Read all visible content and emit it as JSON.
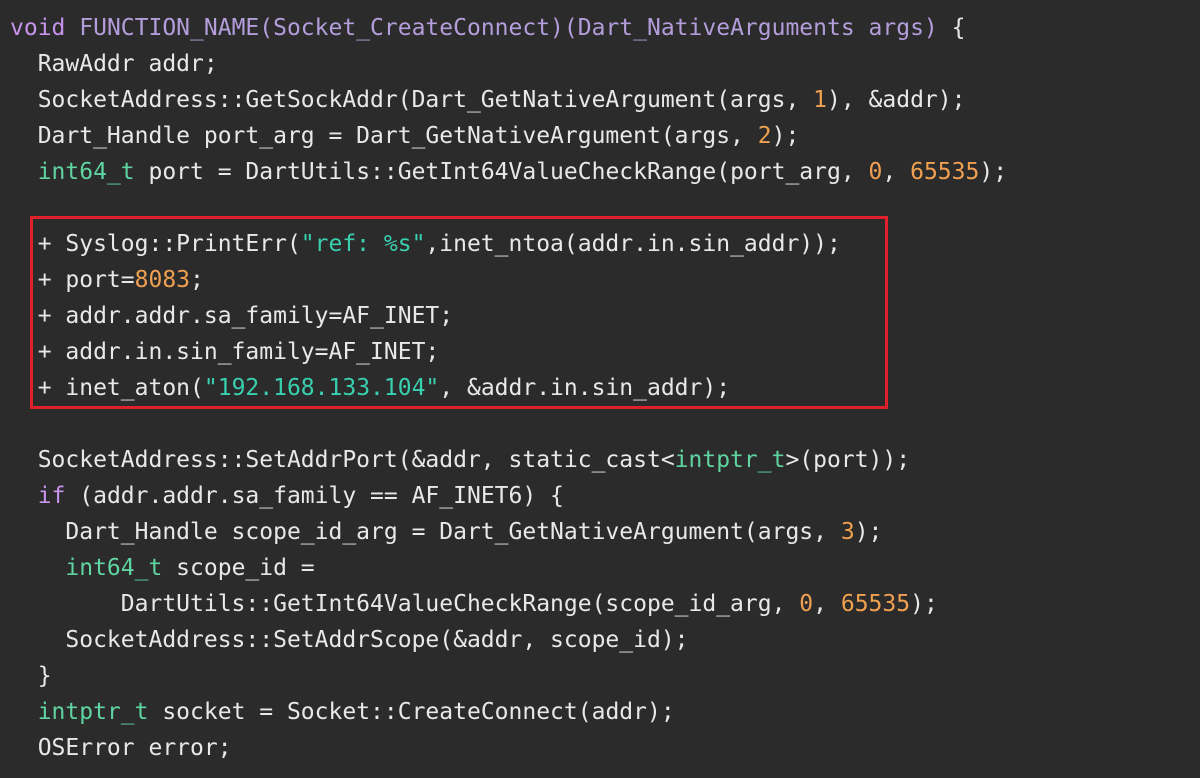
{
  "lines": [
    [
      {
        "t": "void ",
        "c": "kw"
      },
      {
        "t": "FUNCTION_NAME(Socket_CreateConnect)(Dart_NativeArguments args) ",
        "c": "sig"
      },
      {
        "t": "{",
        "c": "plain"
      }
    ],
    [
      {
        "t": "  RawAddr addr;",
        "c": "plain"
      }
    ],
    [
      {
        "t": "  SocketAddress::GetSockAddr(Dart_GetNativeArgument(args, ",
        "c": "plain"
      },
      {
        "t": "1",
        "c": "num"
      },
      {
        "t": "), &addr);",
        "c": "plain"
      }
    ],
    [
      {
        "t": "  Dart_Handle port_arg = Dart_GetNativeArgument(args, ",
        "c": "plain"
      },
      {
        "t": "2",
        "c": "num"
      },
      {
        "t": ");",
        "c": "plain"
      }
    ],
    [
      {
        "t": "  ",
        "c": "plain"
      },
      {
        "t": "int64_t",
        "c": "type"
      },
      {
        "t": " port = DartUtils::GetInt64ValueCheckRange(port_arg, ",
        "c": "plain"
      },
      {
        "t": "0",
        "c": "num"
      },
      {
        "t": ", ",
        "c": "plain"
      },
      {
        "t": "65535",
        "c": "num"
      },
      {
        "t": ");",
        "c": "plain"
      }
    ],
    [
      {
        "t": "",
        "c": "plain"
      }
    ],
    [
      {
        "t": "  + Syslog::PrintErr(",
        "c": "plain"
      },
      {
        "t": "\"ref: %s\"",
        "c": "str"
      },
      {
        "t": ",inet_ntoa(addr.in.sin_addr));",
        "c": "plain"
      }
    ],
    [
      {
        "t": "  + port=",
        "c": "plain"
      },
      {
        "t": "8083",
        "c": "num"
      },
      {
        "t": ";",
        "c": "plain"
      }
    ],
    [
      {
        "t": "  + addr.addr.sa_family=AF_INET;",
        "c": "plain"
      }
    ],
    [
      {
        "t": "  + addr.in.sin_family=AF_INET;",
        "c": "plain"
      }
    ],
    [
      {
        "t": "  + inet_aton(",
        "c": "plain"
      },
      {
        "t": "\"192.168.133.104\"",
        "c": "str"
      },
      {
        "t": ", &addr.in.sin_addr);",
        "c": "plain"
      }
    ],
    [
      {
        "t": "",
        "c": "plain"
      }
    ],
    [
      {
        "t": "  SocketAddress::SetAddrPort(&addr, static_cast<",
        "c": "plain"
      },
      {
        "t": "intptr_t",
        "c": "type"
      },
      {
        "t": ">(port));",
        "c": "plain"
      }
    ],
    [
      {
        "t": "  ",
        "c": "plain"
      },
      {
        "t": "if",
        "c": "kw"
      },
      {
        "t": " (addr.addr.sa_family == AF_INET6) {",
        "c": "plain"
      }
    ],
    [
      {
        "t": "    Dart_Handle scope_id_arg = Dart_GetNativeArgument(args, ",
        "c": "plain"
      },
      {
        "t": "3",
        "c": "num"
      },
      {
        "t": ");",
        "c": "plain"
      }
    ],
    [
      {
        "t": "    ",
        "c": "plain"
      },
      {
        "t": "int64_t",
        "c": "type"
      },
      {
        "t": " scope_id =",
        "c": "plain"
      }
    ],
    [
      {
        "t": "        DartUtils::GetInt64ValueCheckRange(scope_id_arg, ",
        "c": "plain"
      },
      {
        "t": "0",
        "c": "num"
      },
      {
        "t": ", ",
        "c": "plain"
      },
      {
        "t": "65535",
        "c": "num"
      },
      {
        "t": ");",
        "c": "plain"
      }
    ],
    [
      {
        "t": "    SocketAddress::SetAddrScope(&addr, scope_id);",
        "c": "plain"
      }
    ],
    [
      {
        "t": "  }",
        "c": "plain"
      }
    ],
    [
      {
        "t": "  ",
        "c": "plain"
      },
      {
        "t": "intptr_t",
        "c": "type"
      },
      {
        "t": " socket = Socket::CreateConnect(addr);",
        "c": "plain"
      }
    ],
    [
      {
        "t": "  OSError error;",
        "c": "plain"
      }
    ]
  ],
  "colors": {
    "background": "#2b2b2b",
    "highlight_border": "#e0202a",
    "keyword": "#c792ea",
    "signature": "#b39ddb",
    "number": "#f0a050",
    "string": "#39d0b0",
    "type": "#5fd4a0",
    "plain": "#e8e8e8"
  }
}
